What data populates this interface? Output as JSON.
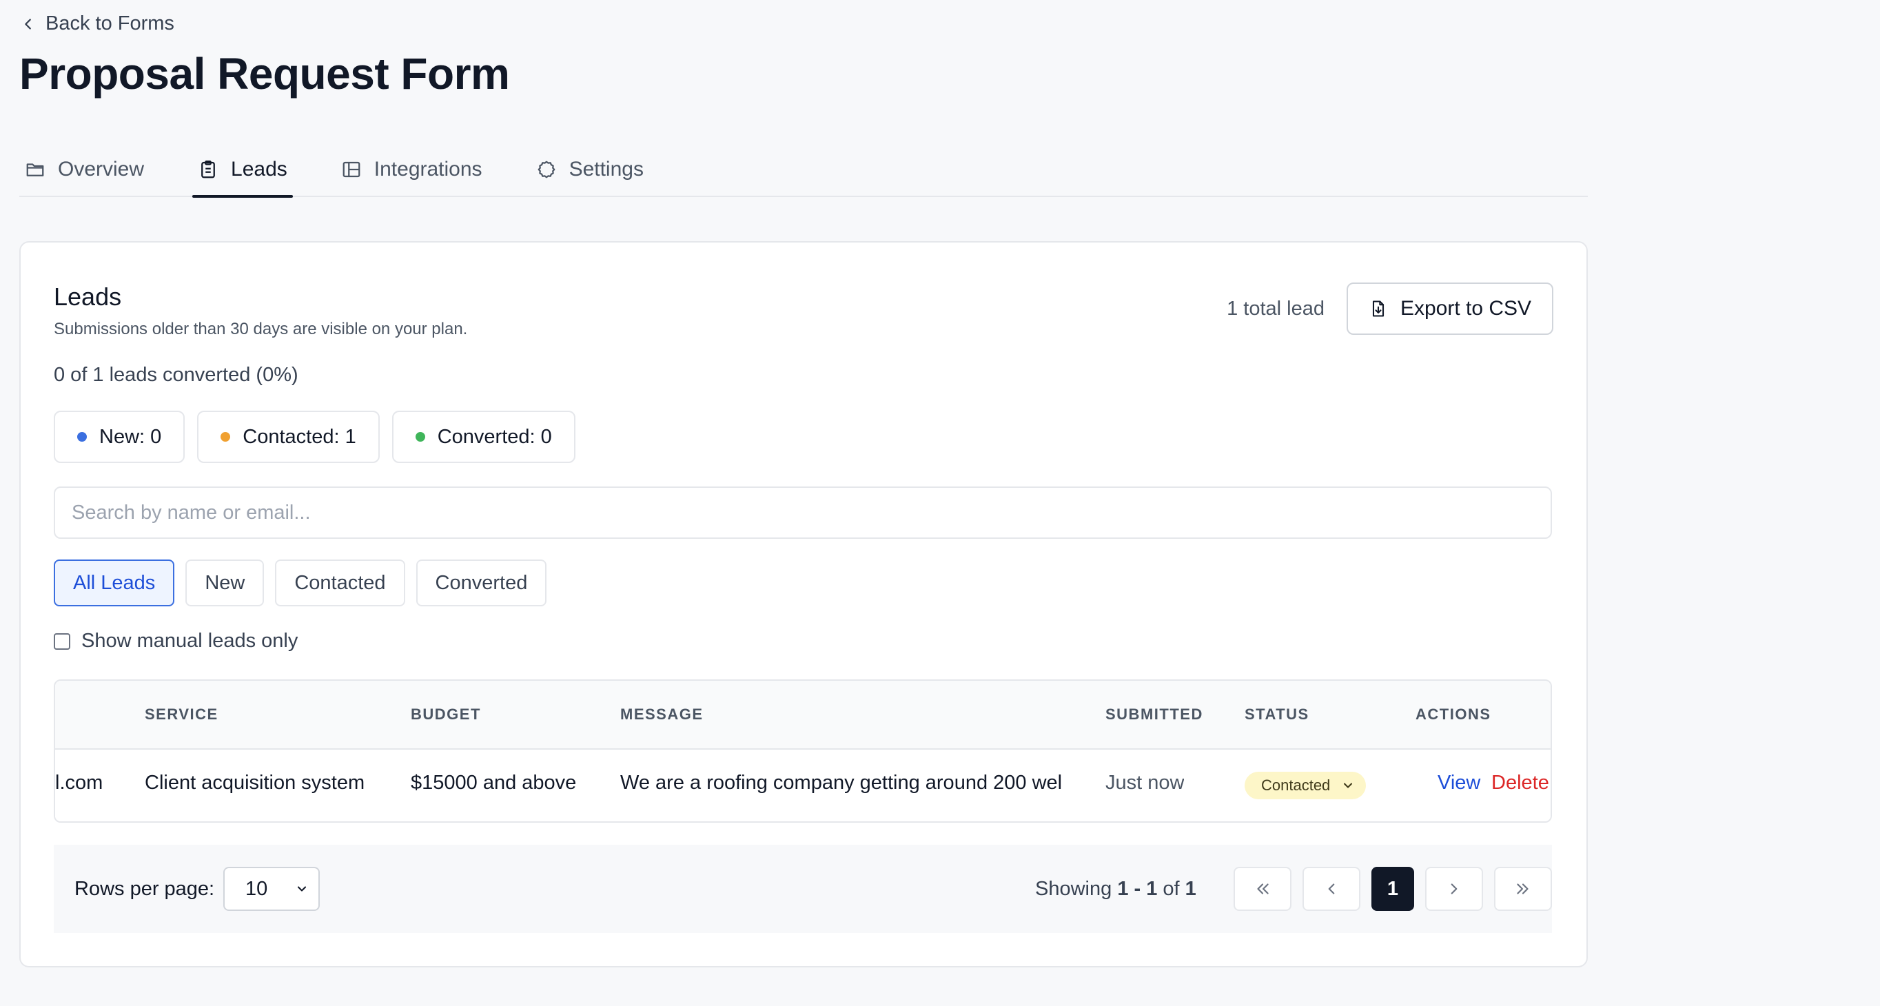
{
  "nav": {
    "back_label": "Back to Forms"
  },
  "page": {
    "title": "Proposal Request Form"
  },
  "tabs": [
    {
      "label": "Overview",
      "icon": "folder-icon",
      "active": false
    },
    {
      "label": "Leads",
      "icon": "clipboard-icon",
      "active": true
    },
    {
      "label": "Integrations",
      "icon": "integrations-icon",
      "active": false
    },
    {
      "label": "Settings",
      "icon": "gear-icon",
      "active": false
    }
  ],
  "leads": {
    "title": "Leads",
    "subtitle": "Submissions older than 30 days are visible on your plan.",
    "total_label": "1 total lead",
    "export_label": "Export to CSV",
    "converted_summary": "0 of 1 leads converted (0%)",
    "status_counts": [
      {
        "label": "New: 0",
        "color": "#3b6fe0"
      },
      {
        "label": "Contacted: 1",
        "color": "#f0a030"
      },
      {
        "label": "Converted: 0",
        "color": "#3fb55a"
      }
    ],
    "search_placeholder": "Search by name or email...",
    "filters": [
      {
        "label": "All Leads",
        "active": true
      },
      {
        "label": "New",
        "active": false
      },
      {
        "label": "Contacted",
        "active": false
      },
      {
        "label": "Converted",
        "active": false
      }
    ],
    "manual_only_label": "Show manual leads only",
    "table": {
      "headers": {
        "service": "SERVICE",
        "budget": "BUDGET",
        "message": "MESSAGE",
        "submitted": "SUBMITTED",
        "status": "STATUS",
        "actions": "ACTIONS"
      },
      "rows": [
        {
          "email_fragment": "l.com",
          "service": "Client acquisition system",
          "budget": "$15000 and above",
          "message": "We are a roofing company getting around 200 wel",
          "submitted": "Just now",
          "status": "Contacted",
          "view_label": "View",
          "delete_label": "Delete"
        }
      ]
    },
    "pagination": {
      "rows_per_page_label": "Rows per page:",
      "rows_per_page_value": "10",
      "showing_prefix": "Showing ",
      "showing_range": "1 - 1",
      "showing_of": " of ",
      "showing_total": "1",
      "current_page": "1"
    }
  },
  "colors": {
    "accent_blue": "#1d4ed8",
    "danger_red": "#dc2626",
    "status_contacted_bg": "#fdf6c8"
  }
}
